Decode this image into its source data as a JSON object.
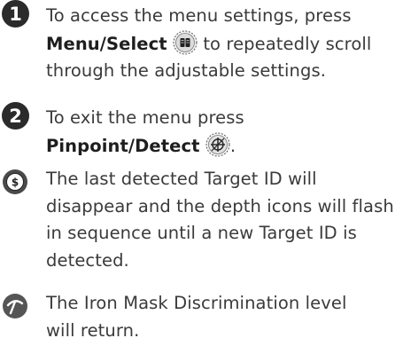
{
  "steps": [
    {
      "number": "1",
      "line1": "To access the menu settings, press",
      "button_label": "Menu/Select",
      "line2_after": "to repeatedly scroll",
      "line3": "through the adjustable settings.",
      "icon": "menu-select-icon"
    },
    {
      "number": "2",
      "line1": "To exit the menu press",
      "button_label": "Pinpoint/Detect",
      "line2_after": ".",
      "icon": "pinpoint-detect-icon"
    }
  ],
  "notes": [
    {
      "icon": "target-id-coin-icon",
      "lines": [
        "The last detected Target ID will",
        "disappear and the depth icons will flash",
        "in sequence until a new Target ID is",
        "detected."
      ]
    },
    {
      "icon": "iron-mask-pick-icon",
      "lines": [
        "The Iron Mask Discrimination level",
        "will return."
      ]
    }
  ]
}
